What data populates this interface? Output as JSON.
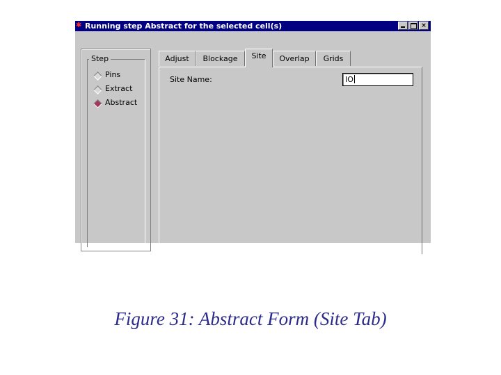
{
  "window": {
    "title": "Running step Abstract for the selected cell(s)",
    "icon": "app-icon",
    "controls": {
      "minimize": "minimize-icon",
      "maximize": "maximize-icon",
      "close": "×"
    }
  },
  "step_group": {
    "label": "Step",
    "options": [
      {
        "label": "Pins",
        "selected": false
      },
      {
        "label": "Extract",
        "selected": false
      },
      {
        "label": "Abstract",
        "selected": true
      }
    ]
  },
  "tabs": [
    {
      "label": "Adjust",
      "active": false
    },
    {
      "label": "Blockage",
      "active": false
    },
    {
      "label": "Site",
      "active": true
    },
    {
      "label": "Overlap",
      "active": false
    },
    {
      "label": "Grids",
      "active": false
    }
  ],
  "site_panel": {
    "site_name_label": "Site Name:",
    "site_name_value": "IO"
  },
  "caption": "Figure 31: Abstract Form (Site Tab)",
  "colors": {
    "titlebar": "#000080",
    "selected_radio": "#a03a5a",
    "caption": "#2b2b8a"
  }
}
